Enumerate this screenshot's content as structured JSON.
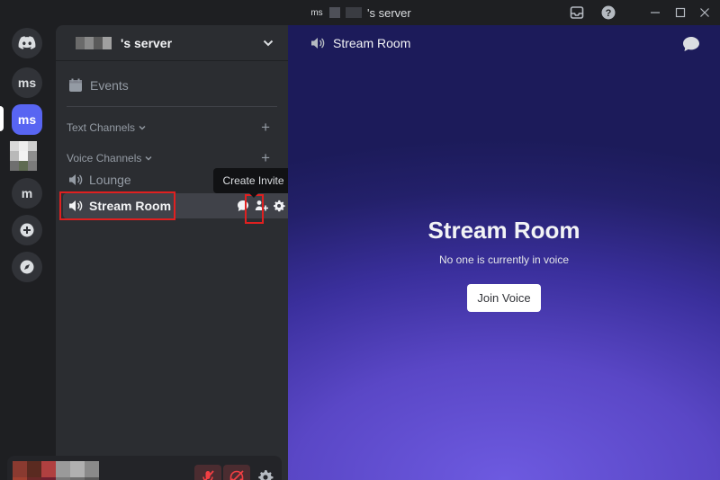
{
  "titlebar": {
    "server_icon_text": "ms",
    "title": "'s server"
  },
  "rail": {
    "items": [
      {
        "name": "discord-home",
        "label": ""
      },
      {
        "name": "server-ms-1",
        "label": "ms"
      },
      {
        "name": "server-ms-2",
        "label": "ms"
      },
      {
        "name": "server-m",
        "label": "m"
      }
    ]
  },
  "sidebar": {
    "server_name": "'s server",
    "events_label": "Events",
    "text_channels_label": "Text Channels",
    "voice_channels_label": "Voice Channels",
    "channels": [
      {
        "name": "Lounge"
      },
      {
        "name": "Stream Room"
      }
    ]
  },
  "tooltip": {
    "text": "Create Invite"
  },
  "main": {
    "header_channel": "Stream Room",
    "voice_title": "Stream Room",
    "voice_subtitle": "No one is currently in voice",
    "join_button": "Join Voice"
  },
  "colors": {
    "accent": "#5865f2",
    "highlight_box": "#e02020",
    "muted_red": "#f23f43"
  }
}
